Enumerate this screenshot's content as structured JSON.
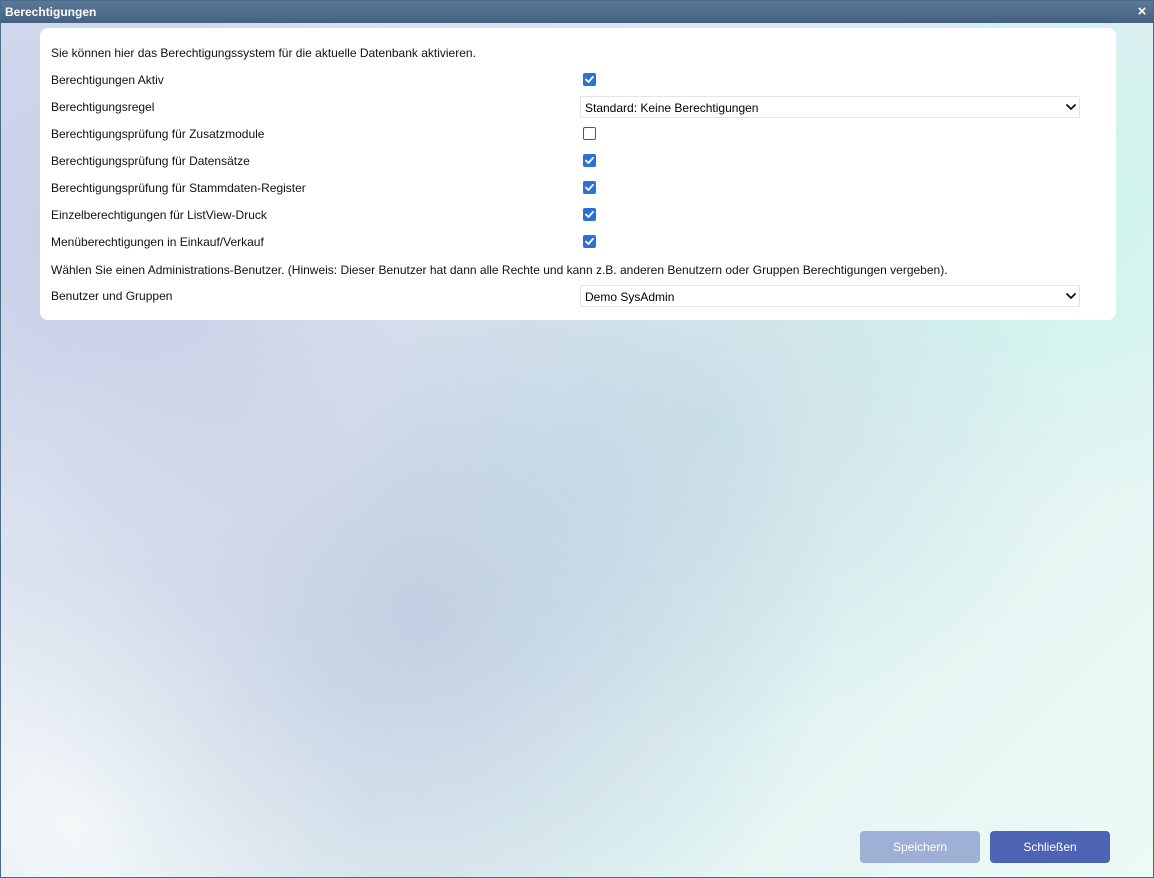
{
  "window": {
    "title": "Berechtigungen",
    "close_symbol": "×"
  },
  "panel": {
    "intro_text": "Sie können hier das Berechtigungssystem für die aktuelle Datenbank aktivieren.",
    "rows": [
      {
        "label": "Berechtigungen Aktiv",
        "type": "checkbox",
        "checked": true
      },
      {
        "label": "Berechtigungsregel",
        "type": "select",
        "value": "Standard: Keine Berechtigungen"
      },
      {
        "label": "Berechtigungsprüfung für Zusatzmodule",
        "type": "checkbox",
        "checked": false
      },
      {
        "label": "Berechtigungsprüfung für Datensätze",
        "type": "checkbox",
        "checked": true
      },
      {
        "label": "Berechtigungsprüfung für Stammdaten-Register",
        "type": "checkbox",
        "checked": true
      },
      {
        "label": "Einzelberechtigungen für ListView-Druck",
        "type": "checkbox",
        "checked": true
      },
      {
        "label": "Menüberechtigungen in Einkauf/Verkauf",
        "type": "checkbox",
        "checked": true
      }
    ],
    "hint_text": "Wählen Sie einen Administrations-Benutzer. (Hinweis: Dieser Benutzer hat dann alle Rechte und kann z.B. anderen Benutzern oder Gruppen Berechtigungen vergeben).",
    "users_row": {
      "label": "Benutzer und Gruppen",
      "type": "select",
      "value": "Demo SysAdmin"
    }
  },
  "buttons": {
    "save_label": "Speichern",
    "close_label": "Schließen"
  },
  "colors": {
    "titlebar": "#45617f",
    "checkbox_accent": "#2a73d4",
    "save_button": "#9fb0d6",
    "close_button": "#4d63b3"
  },
  "icons": {
    "close": "close-icon",
    "checkmark": "checkmark-icon",
    "dropdown": "chevron-down-icon"
  }
}
